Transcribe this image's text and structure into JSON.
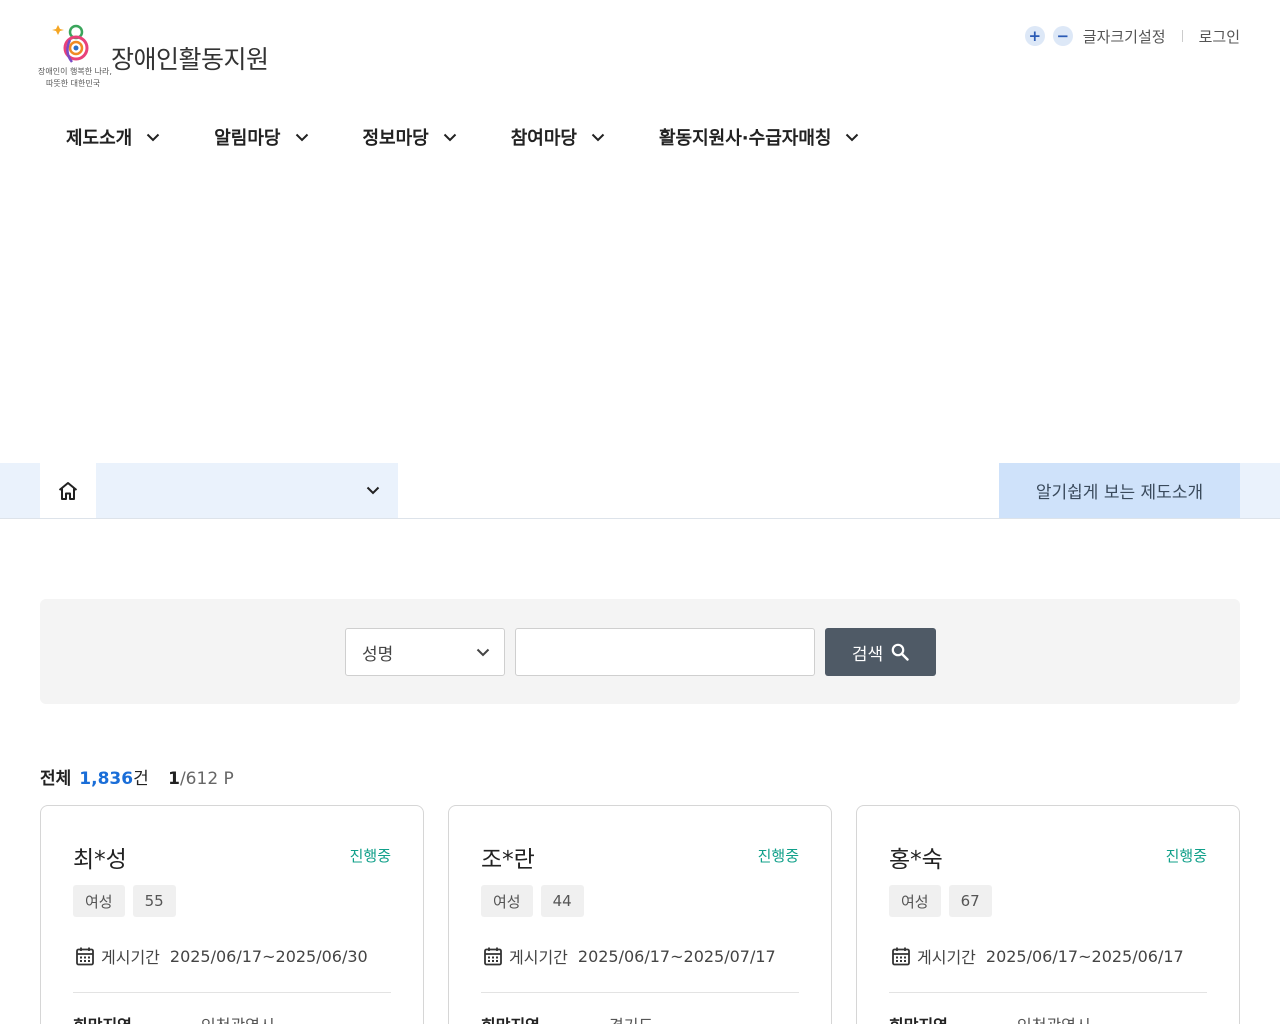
{
  "header": {
    "logo": {
      "title": "장애인활동지원",
      "tagline_line1": "장애인이 행복한 나라,",
      "tagline_line2": "따뜻한 대한민국"
    },
    "utility": {
      "font_increase": "+",
      "font_decrease": "−",
      "font_setting_label": "글자크기설정",
      "login_label": "로그인"
    },
    "nav": [
      {
        "label": "제도소개"
      },
      {
        "label": "알림마당"
      },
      {
        "label": "정보마당"
      },
      {
        "label": "참여마당"
      },
      {
        "label": "활동지원사·수급자매칭"
      }
    ]
  },
  "breadcrumb": {
    "home_icon": "home-icon",
    "select_value": "",
    "guide_button": "알기쉽게 보는 제도소개"
  },
  "search": {
    "field_select": "성명",
    "query_value": "",
    "button_label": "검색"
  },
  "totals": {
    "label": "전체",
    "count": "1,836",
    "count_unit": "건",
    "current_page": "1",
    "total_pages": "/612 P"
  },
  "cards": [
    {
      "name": "최*성",
      "status": "진행중",
      "gender": "여성",
      "age": "55",
      "period_label": "게시기간",
      "period": "2025/06/17~2025/06/30",
      "region_label": "희망지역",
      "region": "인천광역시"
    },
    {
      "name": "조*란",
      "status": "진행중",
      "gender": "여성",
      "age": "44",
      "period_label": "게시기간",
      "period": "2025/06/17~2025/07/17",
      "region_label": "희망지역",
      "region": "경기도"
    },
    {
      "name": "홍*숙",
      "status": "진행중",
      "gender": "여성",
      "age": "67",
      "period_label": "게시기간",
      "period": "2025/06/17~2025/06/17",
      "region_label": "희망지역",
      "region": "인천광역시"
    }
  ],
  "colors": {
    "accent_blue": "#1a6ed8",
    "status_green": "#11a08a",
    "search_button": "#4f5a66",
    "breadcrumb_bg": "#eaf2fc",
    "guide_bg": "#cfe2fa"
  }
}
